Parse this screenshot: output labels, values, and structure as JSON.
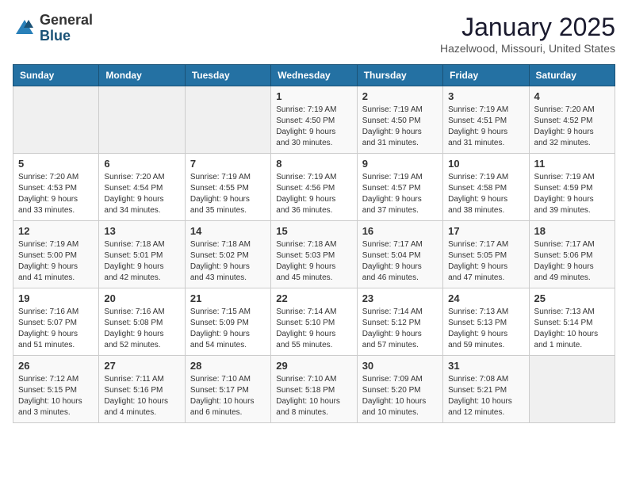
{
  "logo": {
    "general": "General",
    "blue": "Blue"
  },
  "header": {
    "month": "January 2025",
    "location": "Hazelwood, Missouri, United States"
  },
  "weekdays": [
    "Sunday",
    "Monday",
    "Tuesday",
    "Wednesday",
    "Thursday",
    "Friday",
    "Saturday"
  ],
  "weeks": [
    [
      {
        "day": "",
        "info": ""
      },
      {
        "day": "",
        "info": ""
      },
      {
        "day": "",
        "info": ""
      },
      {
        "day": "1",
        "info": "Sunrise: 7:19 AM\nSunset: 4:50 PM\nDaylight: 9 hours\nand 30 minutes."
      },
      {
        "day": "2",
        "info": "Sunrise: 7:19 AM\nSunset: 4:50 PM\nDaylight: 9 hours\nand 31 minutes."
      },
      {
        "day": "3",
        "info": "Sunrise: 7:19 AM\nSunset: 4:51 PM\nDaylight: 9 hours\nand 31 minutes."
      },
      {
        "day": "4",
        "info": "Sunrise: 7:20 AM\nSunset: 4:52 PM\nDaylight: 9 hours\nand 32 minutes."
      }
    ],
    [
      {
        "day": "5",
        "info": "Sunrise: 7:20 AM\nSunset: 4:53 PM\nDaylight: 9 hours\nand 33 minutes."
      },
      {
        "day": "6",
        "info": "Sunrise: 7:20 AM\nSunset: 4:54 PM\nDaylight: 9 hours\nand 34 minutes."
      },
      {
        "day": "7",
        "info": "Sunrise: 7:19 AM\nSunset: 4:55 PM\nDaylight: 9 hours\nand 35 minutes."
      },
      {
        "day": "8",
        "info": "Sunrise: 7:19 AM\nSunset: 4:56 PM\nDaylight: 9 hours\nand 36 minutes."
      },
      {
        "day": "9",
        "info": "Sunrise: 7:19 AM\nSunset: 4:57 PM\nDaylight: 9 hours\nand 37 minutes."
      },
      {
        "day": "10",
        "info": "Sunrise: 7:19 AM\nSunset: 4:58 PM\nDaylight: 9 hours\nand 38 minutes."
      },
      {
        "day": "11",
        "info": "Sunrise: 7:19 AM\nSunset: 4:59 PM\nDaylight: 9 hours\nand 39 minutes."
      }
    ],
    [
      {
        "day": "12",
        "info": "Sunrise: 7:19 AM\nSunset: 5:00 PM\nDaylight: 9 hours\nand 41 minutes."
      },
      {
        "day": "13",
        "info": "Sunrise: 7:18 AM\nSunset: 5:01 PM\nDaylight: 9 hours\nand 42 minutes."
      },
      {
        "day": "14",
        "info": "Sunrise: 7:18 AM\nSunset: 5:02 PM\nDaylight: 9 hours\nand 43 minutes."
      },
      {
        "day": "15",
        "info": "Sunrise: 7:18 AM\nSunset: 5:03 PM\nDaylight: 9 hours\nand 45 minutes."
      },
      {
        "day": "16",
        "info": "Sunrise: 7:17 AM\nSunset: 5:04 PM\nDaylight: 9 hours\nand 46 minutes."
      },
      {
        "day": "17",
        "info": "Sunrise: 7:17 AM\nSunset: 5:05 PM\nDaylight: 9 hours\nand 47 minutes."
      },
      {
        "day": "18",
        "info": "Sunrise: 7:17 AM\nSunset: 5:06 PM\nDaylight: 9 hours\nand 49 minutes."
      }
    ],
    [
      {
        "day": "19",
        "info": "Sunrise: 7:16 AM\nSunset: 5:07 PM\nDaylight: 9 hours\nand 51 minutes."
      },
      {
        "day": "20",
        "info": "Sunrise: 7:16 AM\nSunset: 5:08 PM\nDaylight: 9 hours\nand 52 minutes."
      },
      {
        "day": "21",
        "info": "Sunrise: 7:15 AM\nSunset: 5:09 PM\nDaylight: 9 hours\nand 54 minutes."
      },
      {
        "day": "22",
        "info": "Sunrise: 7:14 AM\nSunset: 5:10 PM\nDaylight: 9 hours\nand 55 minutes."
      },
      {
        "day": "23",
        "info": "Sunrise: 7:14 AM\nSunset: 5:12 PM\nDaylight: 9 hours\nand 57 minutes."
      },
      {
        "day": "24",
        "info": "Sunrise: 7:13 AM\nSunset: 5:13 PM\nDaylight: 9 hours\nand 59 minutes."
      },
      {
        "day": "25",
        "info": "Sunrise: 7:13 AM\nSunset: 5:14 PM\nDaylight: 10 hours\nand 1 minute."
      }
    ],
    [
      {
        "day": "26",
        "info": "Sunrise: 7:12 AM\nSunset: 5:15 PM\nDaylight: 10 hours\nand 3 minutes."
      },
      {
        "day": "27",
        "info": "Sunrise: 7:11 AM\nSunset: 5:16 PM\nDaylight: 10 hours\nand 4 minutes."
      },
      {
        "day": "28",
        "info": "Sunrise: 7:10 AM\nSunset: 5:17 PM\nDaylight: 10 hours\nand 6 minutes."
      },
      {
        "day": "29",
        "info": "Sunrise: 7:10 AM\nSunset: 5:18 PM\nDaylight: 10 hours\nand 8 minutes."
      },
      {
        "day": "30",
        "info": "Sunrise: 7:09 AM\nSunset: 5:20 PM\nDaylight: 10 hours\nand 10 minutes."
      },
      {
        "day": "31",
        "info": "Sunrise: 7:08 AM\nSunset: 5:21 PM\nDaylight: 10 hours\nand 12 minutes."
      },
      {
        "day": "",
        "info": ""
      }
    ]
  ]
}
